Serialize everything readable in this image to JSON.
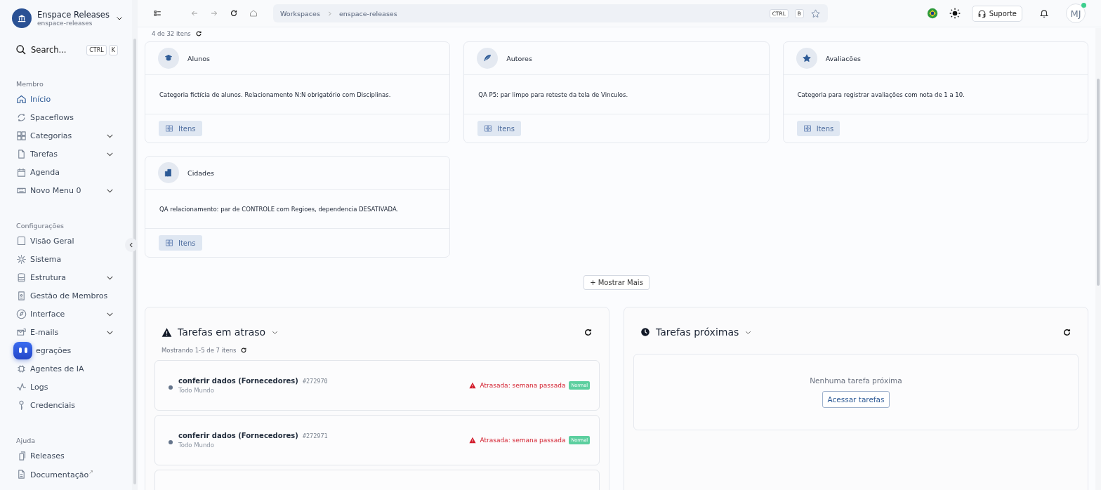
{
  "workspace": {
    "name": "Enspace Releases",
    "slug": "enspace-releases"
  },
  "search": {
    "placeholder": "Search...",
    "keys": [
      "CTRL",
      "K"
    ]
  },
  "sidebar": [
    {
      "heading": "Membro",
      "items": [
        {
          "label": "Início",
          "selected": true,
          "expandable": false
        },
        {
          "label": "Spaceflows",
          "selected": false,
          "expandable": false
        },
        {
          "label": "Categorias",
          "selected": false,
          "expandable": true
        },
        {
          "label": "Tarefas",
          "selected": false,
          "expandable": true
        },
        {
          "label": "Agenda",
          "selected": false,
          "expandable": false
        },
        {
          "label": "Novo Menu 0",
          "selected": false,
          "expandable": true
        }
      ]
    },
    {
      "heading": "Configurações",
      "items": [
        {
          "label": "Visão Geral",
          "selected": false,
          "expandable": false
        },
        {
          "label": "Sistema",
          "selected": false,
          "expandable": false
        },
        {
          "label": "Estrutura",
          "selected": false,
          "expandable": true
        },
        {
          "label": "Gestão de Membros",
          "selected": false,
          "expandable": false
        },
        {
          "label": "Interface",
          "selected": false,
          "expandable": true
        },
        {
          "label": "E-mails",
          "selected": false,
          "expandable": true
        },
        {
          "label": "egrações",
          "selected": false,
          "expandable": false,
          "kind": "covered"
        },
        {
          "label": "Agentes de IA",
          "selected": false,
          "expandable": false
        },
        {
          "label": "Logs",
          "selected": false,
          "expandable": false
        },
        {
          "label": "Credenciais",
          "selected": false,
          "expandable": false
        }
      ]
    },
    {
      "heading": "Ajuda",
      "items": [
        {
          "label": "Releases",
          "selected": false,
          "expandable": false
        },
        {
          "label": "Documentação",
          "selected": false,
          "expandable": false,
          "external_mark": "↗"
        }
      ]
    }
  ],
  "breadcrumb": [
    "Workspaces",
    "enspace-releases"
  ],
  "shortcut": [
    "CTRL",
    "B"
  ],
  "topbar": {
    "support": "Suporte",
    "avatar": "MJ",
    "online": true
  },
  "count": "4 de 32 itens",
  "categories": [
    {
      "name": "Alunos",
      "description": "Categoria fictícia de alunos. Relacionamento N:N obrigatório com Disciplinas.",
      "action": "Itens"
    },
    {
      "name": "Autores",
      "description": "QA P5: par limpo para reteste da tela de Vinculos.",
      "action": "Itens"
    },
    {
      "name": "Avaliacões",
      "description": "Categoria para registrar avaliações com nota de 1 a 10.",
      "action": "Itens"
    },
    {
      "name": "Cidades",
      "description": "QA relacionamento: par de CONTROLE com Regioes, dependencia DESATIVADA.",
      "action": "Itens"
    }
  ],
  "show_more": "+ Mostrar Mais",
  "overdue": {
    "title": "Tarefas em atraso",
    "summary": "Mostrando 1-5 de 7 itens",
    "tasks": [
      {
        "title": "conferir dados (Fornecedores)",
        "id": "#272970",
        "assignee": "Todo Mundo",
        "status_label": "Atrasada:",
        "status": "semana passada",
        "priority": "Normal"
      },
      {
        "title": "conferir dados (Fornecedores)",
        "id": "#272971",
        "assignee": "Todo Mundo",
        "status_label": "Atrasada:",
        "status": "semana passada",
        "priority": "Normal"
      }
    ]
  },
  "upcoming": {
    "title": "Tarefas próximas",
    "empty": "Nenhuma tarefa próxima",
    "action": "Acessar tarefas"
  }
}
